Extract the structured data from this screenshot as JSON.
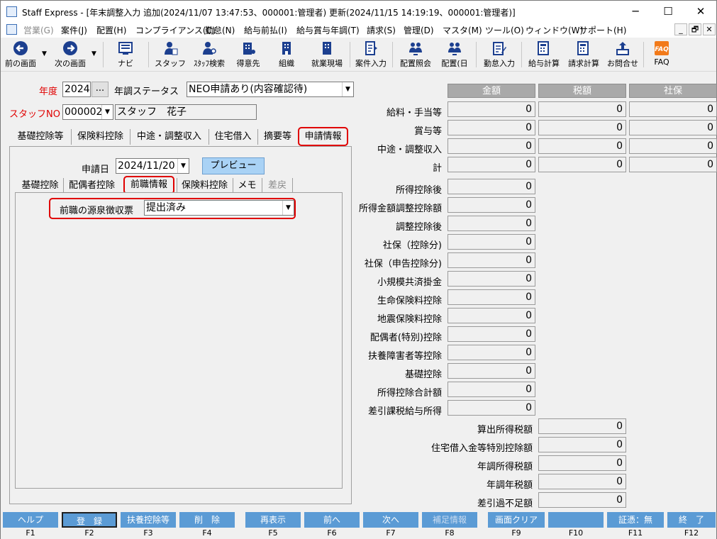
{
  "window": {
    "title": "Staff Express - [年末調整入力 追加(2024/11/07 13:47:53、000001:管理者) 更新(2024/11/15 14:19:19、000001:管理者)]",
    "controls": [
      "─",
      "☐",
      "✕"
    ]
  },
  "menu": {
    "items": [
      "営業(G)",
      "案件(J)",
      "配置(H)",
      "コンプライアンス(C)",
      "勤怠(N)",
      "給与前払(I)",
      "給与賞与年調(T)",
      "請求(S)",
      "管理(D)",
      "マスタ(M)",
      "ツール(O)",
      "ウィンドウ(W)",
      "サポート(H)"
    ],
    "mdi": [
      "_",
      "🗗",
      "✕"
    ]
  },
  "toolbar": {
    "buttons": [
      {
        "label": "前の画面",
        "icon": "back-arrow-icon"
      },
      {
        "label": "次の画面",
        "icon": "forward-arrow-icon"
      },
      {
        "label": "ナビ",
        "icon": "navi-icon"
      },
      {
        "label": "スタッフ",
        "icon": "staff-icon"
      },
      {
        "label": "ｽﾀｯﾌ検索",
        "icon": "staff-search-icon"
      },
      {
        "label": "得意先",
        "icon": "customer-icon"
      },
      {
        "label": "組織",
        "icon": "organization-icon"
      },
      {
        "label": "就業現場",
        "icon": "worksite-icon"
      },
      {
        "label": "案件入力",
        "icon": "job-entry-icon"
      },
      {
        "label": "配置照会",
        "icon": "placement-inquiry-icon"
      },
      {
        "label": "配置(日",
        "icon": "placement-daily-icon"
      },
      {
        "label": "勤怠入力",
        "icon": "attendance-entry-icon"
      },
      {
        "label": "給与計算",
        "icon": "payroll-calc-icon"
      },
      {
        "label": "請求計算",
        "icon": "billing-calc-icon"
      },
      {
        "label": "お問合せ",
        "icon": "inquiry-icon"
      },
      {
        "label": "FAQ",
        "icon": "faq-icon"
      }
    ]
  },
  "form": {
    "year_label": "年度",
    "year_value": "2024",
    "year_button": "...",
    "status_label": "年調ステータス",
    "status_value": "NEO申請あり(内容確認待)",
    "staff_label": "スタッフNO",
    "staff_no": "000002",
    "staff_name": "スタッフ　花子"
  },
  "outer_tabs": [
    "基礎控除等",
    "保険料控除",
    "中途・調整収入",
    "住宅借入",
    "摘要等",
    "申請情報"
  ],
  "application": {
    "date_label": "申請日",
    "date_value": "2024/11/20",
    "preview_label": "プレビュー",
    "inner_tabs": [
      "基礎控除",
      "配偶者控除",
      "前職情報",
      "保険料控除",
      "メモ",
      "差戻"
    ],
    "prev_job_label": "前職の源泉徴収票",
    "prev_job_value": "提出済み"
  },
  "summary": {
    "headers": [
      "金額",
      "税額",
      "社保"
    ],
    "top_rows": [
      {
        "label": "給料・手当等",
        "values": [
          "0",
          "0",
          "0"
        ]
      },
      {
        "label": "賞与等",
        "values": [
          "0",
          "0",
          "0"
        ]
      },
      {
        "label": "中途・調整収入",
        "values": [
          "0",
          "0",
          "0"
        ]
      },
      {
        "label": "計",
        "values": [
          "0",
          "0",
          "0"
        ]
      }
    ],
    "middle_rows": [
      {
        "label": "所得控除後",
        "value": "0"
      },
      {
        "label": "所得金額調整控除額",
        "value": "0"
      },
      {
        "label": "調整控除後",
        "value": "0"
      },
      {
        "label": "社保（控除分)",
        "value": "0"
      },
      {
        "label": "社保（申告控除分)",
        "value": "0"
      },
      {
        "label": "小規模共済掛金",
        "value": "0"
      },
      {
        "label": "生命保険料控除",
        "value": "0"
      },
      {
        "label": "地震保険料控除",
        "value": "0"
      },
      {
        "label": "配偶者(特別)控除",
        "value": "0"
      },
      {
        "label": "扶養障害者等控除",
        "value": "0"
      },
      {
        "label": "基礎控除",
        "value": "0"
      },
      {
        "label": "所得控除合計額",
        "value": "0"
      },
      {
        "label": "差引課税給与所得",
        "value": "0"
      }
    ],
    "bottom_rows": [
      {
        "label": "算出所得税額",
        "value": "0"
      },
      {
        "label": "住宅借入金等特別控除額",
        "value": "0"
      },
      {
        "label": "年調所得税額",
        "value": "0"
      },
      {
        "label": "年調年税額",
        "value": "0"
      },
      {
        "label": "差引過不足額",
        "value": "0"
      }
    ]
  },
  "fkeys": [
    {
      "label": "ヘルプ",
      "key": "F1"
    },
    {
      "label": "登　録",
      "key": "F2"
    },
    {
      "label": "扶養控除等",
      "key": "F3"
    },
    {
      "label": "削　除",
      "key": "F4"
    },
    {
      "label": "再表示",
      "key": "F5"
    },
    {
      "label": "前へ",
      "key": "F6"
    },
    {
      "label": "次へ",
      "key": "F7"
    },
    {
      "label": "補足情報",
      "key": "F8"
    },
    {
      "label": "画面クリア",
      "key": "F9"
    },
    {
      "label": "",
      "key": "F10"
    },
    {
      "label": "証憑：無",
      "key": "F11"
    },
    {
      "label": "終　了",
      "key": "F12"
    }
  ]
}
